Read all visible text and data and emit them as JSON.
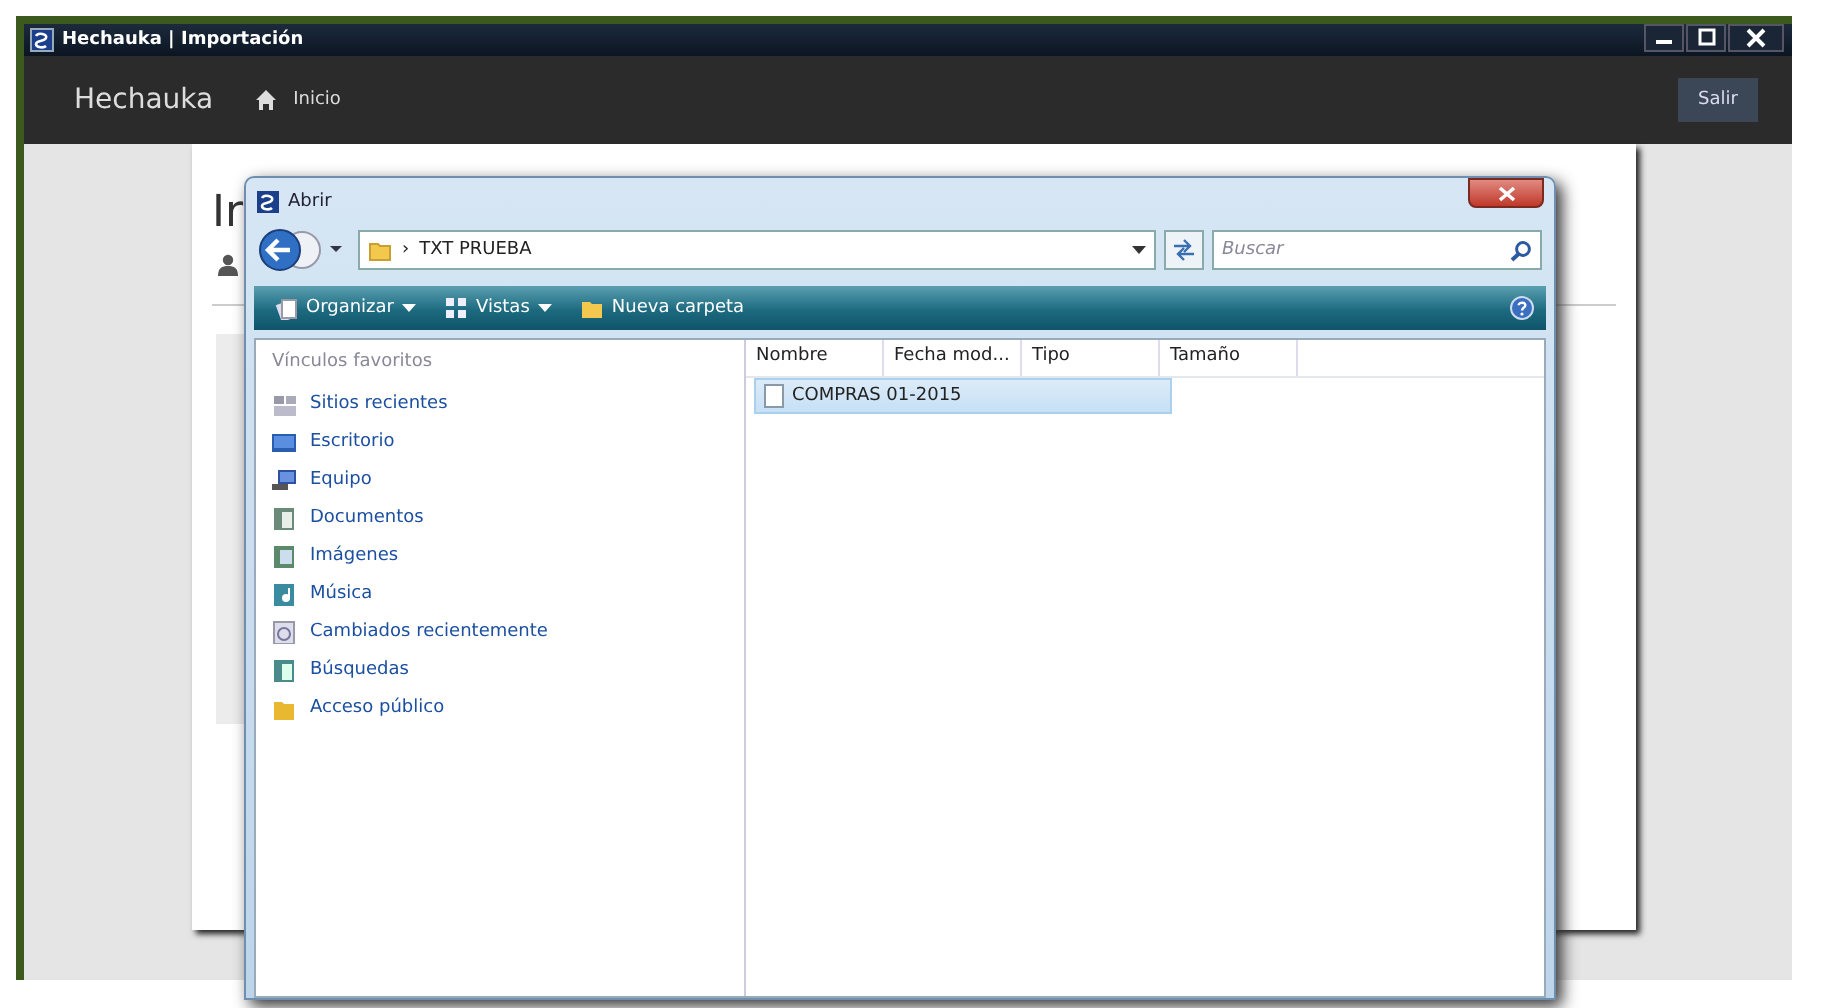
{
  "window": {
    "title": "Hechauka | Importación"
  },
  "navbar": {
    "brand": "Hechauka",
    "items": [
      {
        "label": "Inicio"
      }
    ],
    "logout_button": "Salir"
  },
  "page": {
    "heading": "Ir"
  },
  "dialog": {
    "title": "Abrir",
    "address": {
      "separator": "›",
      "path": "TXT PRUEBA"
    },
    "search": {
      "placeholder": "Buscar"
    },
    "toolbar": [
      {
        "label": "Organizar",
        "dropdown": true
      },
      {
        "label": "Vistas",
        "dropdown": true
      },
      {
        "label": "Nueva carpeta",
        "dropdown": false
      }
    ],
    "favorites": {
      "header": "Vínculos favoritos",
      "items": [
        {
          "label": "Sitios recientes"
        },
        {
          "label": "Escritorio"
        },
        {
          "label": "Equipo"
        },
        {
          "label": "Documentos"
        },
        {
          "label": "Imágenes"
        },
        {
          "label": "Música"
        },
        {
          "label": "Cambiados recientemente"
        },
        {
          "label": "Búsquedas"
        },
        {
          "label": "Acceso público"
        }
      ]
    },
    "columns": [
      "Nombre",
      "Fecha mod...",
      "Tipo",
      "Tamaño"
    ],
    "files": [
      {
        "name": "COMPRAS 01-2015",
        "selected": true
      }
    ]
  }
}
